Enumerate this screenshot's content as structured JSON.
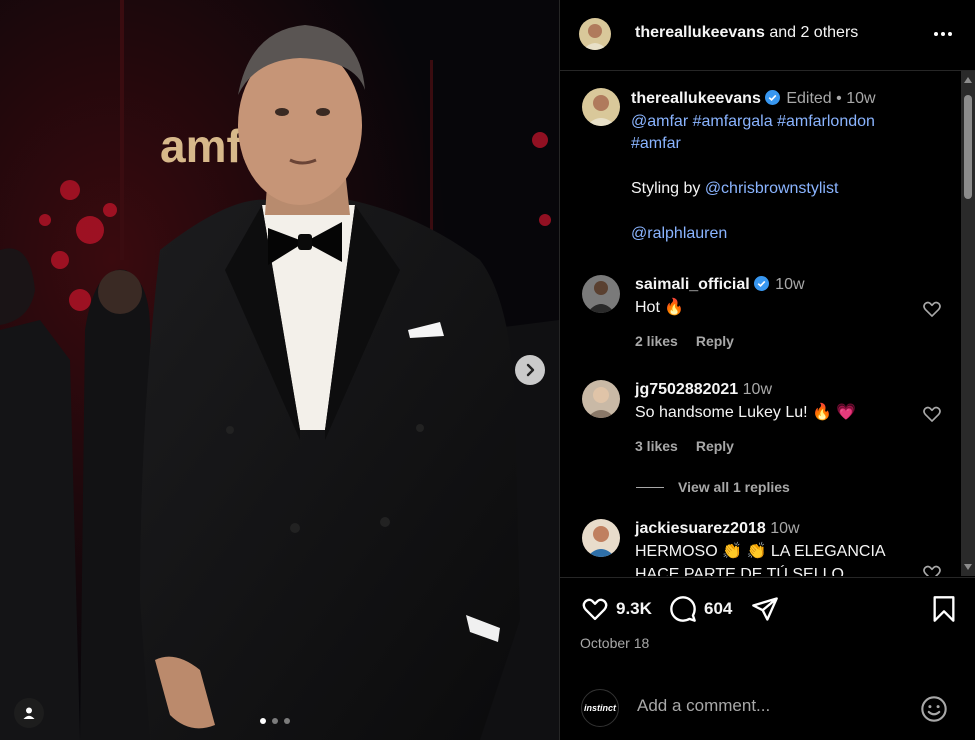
{
  "post": {
    "author": "thereallukeevans",
    "collab_suffix": "and 2 others",
    "venue_sign": "amfaR",
    "slide_count": 3,
    "active_slide": 1
  },
  "caption": {
    "username": "thereallukeevans",
    "edited": "Edited",
    "separator": "•",
    "time": "10w",
    "line1": "@amfar #amfargala #amfarlondon",
    "line2": "#amfar",
    "styling_prefix": "Styling by ",
    "styling_handle": "@chrisbrownstylist",
    "brand_handle": "@ralphlauren"
  },
  "comments": [
    {
      "username": "saimali_official",
      "verified": true,
      "time": "10w",
      "text": "Hot 🔥",
      "likes": "2 likes",
      "reply": "Reply"
    },
    {
      "username": "jg7502882021",
      "verified": false,
      "time": "10w",
      "text": "So handsome Lukey Lu! 🔥 💗",
      "likes": "3 likes",
      "reply": "Reply"
    },
    {
      "username": "jackiesuarez2018",
      "verified": false,
      "time": "10w",
      "text": "HERMOSO 👏 👏 LA ELEGANCIA HACE PARTE DE TÚ SELLO"
    }
  ],
  "view_replies": "View all 1 replies",
  "actions": {
    "likes": "9.3K",
    "comments": "604",
    "date": "October 18"
  },
  "composer": {
    "avatar_label": "instinct",
    "placeholder": "Add a comment..."
  },
  "colors": {
    "link": "#8ab4ff",
    "verified": "#3897f0",
    "muted": "#a8a8a8",
    "background": "#000000"
  }
}
